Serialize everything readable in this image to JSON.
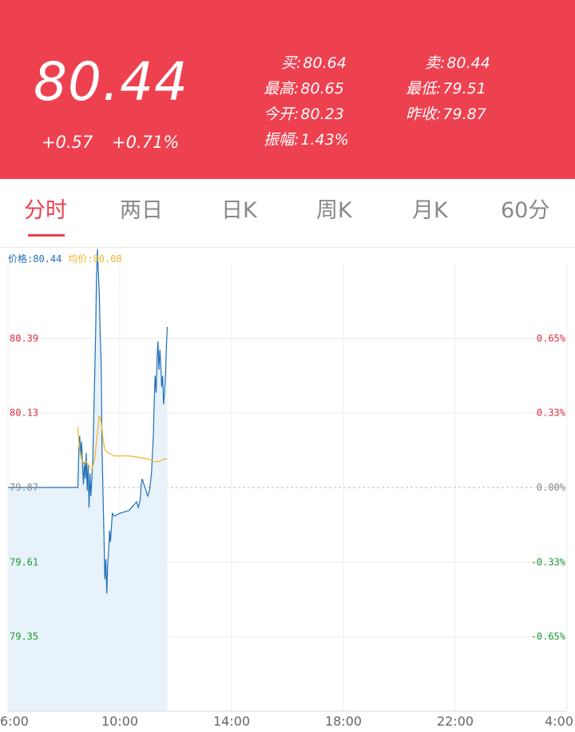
{
  "quote": {
    "price": "80.44",
    "change": "+0.57",
    "change_pct": "+0.71%",
    "stats": [
      {
        "label": "买:",
        "value": "80.64"
      },
      {
        "label": "卖:",
        "value": "80.44"
      },
      {
        "label": "最高:",
        "value": "80.65"
      },
      {
        "label": "最低:",
        "value": "79.51"
      },
      {
        "label": "今开:",
        "value": "80.23"
      },
      {
        "label": "昨收:",
        "value": "79.87"
      },
      {
        "label": "振幅:",
        "value": "1.43%"
      }
    ]
  },
  "tabs": [
    {
      "label": "分时",
      "active": true
    },
    {
      "label": "两日",
      "active": false
    },
    {
      "label": "日K",
      "active": false
    },
    {
      "label": "周K",
      "active": false
    },
    {
      "label": "月K",
      "active": false
    },
    {
      "label": "60分",
      "active": false
    }
  ],
  "legend": {
    "price": "价格:80.44",
    "avg": "均价:80.08"
  },
  "colors": {
    "header": "#ee4150",
    "up": "#e0303f",
    "down": "#1a9a2e",
    "price_line": "#1f6fb8",
    "avg_line": "#f0b429"
  },
  "chart_data": {
    "type": "line",
    "x_ticks": [
      "6:00",
      "10:00",
      "14:00",
      "18:00",
      "22:00",
      "4:00"
    ],
    "y_ticks": [
      "80.39",
      "80.13",
      "79.87",
      "79.61",
      "79.35"
    ],
    "y_right_ticks": [
      "0.65%",
      "0.33%",
      "0.00%",
      "-0.33%",
      "-0.65%"
    ],
    "ylim": [
      79.09,
      80.65
    ],
    "prev_close": 79.87,
    "series": [
      {
        "name": "价格",
        "points": [
          [
            0,
            79.87
          ],
          [
            75,
            79.87
          ],
          [
            76,
            80.0
          ],
          [
            77,
            80.05
          ],
          [
            78,
            79.98
          ],
          [
            79,
            80.03
          ],
          [
            80,
            79.95
          ],
          [
            81,
            79.88
          ],
          [
            82,
            79.96
          ],
          [
            83,
            79.9
          ],
          [
            84,
            79.99
          ],
          [
            85,
            79.86
          ],
          [
            86,
            79.95
          ],
          [
            87,
            79.8
          ],
          [
            88,
            79.92
          ],
          [
            89,
            79.84
          ],
          [
            91,
            79.96
          ],
          [
            92,
            80.1
          ],
          [
            93,
            80.25
          ],
          [
            94,
            80.4
          ],
          [
            95,
            80.6
          ],
          [
            96,
            80.7
          ],
          [
            97,
            80.62
          ],
          [
            98,
            80.55
          ],
          [
            99,
            80.4
          ],
          [
            100,
            80.3
          ],
          [
            101,
            80.0
          ],
          [
            102,
            79.85
          ],
          [
            103,
            79.7
          ],
          [
            104,
            79.55
          ],
          [
            105,
            79.62
          ],
          [
            106,
            79.5
          ],
          [
            107,
            79.6
          ],
          [
            108,
            79.65
          ],
          [
            109,
            79.72
          ],
          [
            110,
            79.68
          ],
          [
            112,
            79.78
          ],
          [
            114,
            79.77
          ],
          [
            120,
            79.78
          ],
          [
            130,
            79.79
          ],
          [
            138,
            79.82
          ],
          [
            140,
            79.8
          ],
          [
            142,
            79.83
          ],
          [
            143,
            79.88
          ],
          [
            144,
            79.9
          ],
          [
            146,
            79.88
          ],
          [
            148,
            79.86
          ],
          [
            150,
            79.84
          ],
          [
            152,
            79.86
          ],
          [
            154,
            79.92
          ],
          [
            156,
            80.05
          ],
          [
            157,
            80.18
          ],
          [
            158,
            80.26
          ],
          [
            159,
            80.2
          ],
          [
            160,
            80.32
          ],
          [
            161,
            80.38
          ],
          [
            162,
            80.28
          ],
          [
            163,
            80.35
          ],
          [
            164,
            80.3
          ],
          [
            165,
            80.22
          ],
          [
            166,
            80.26
          ],
          [
            167,
            80.16
          ],
          [
            168,
            80.2
          ],
          [
            169,
            80.26
          ],
          [
            170,
            80.36
          ],
          [
            171,
            80.43
          ]
        ]
      },
      {
        "name": "均价",
        "points": [
          [
            75,
            80.08
          ],
          [
            76,
            80.03
          ],
          [
            78,
            79.98
          ],
          [
            80,
            79.96
          ],
          [
            82,
            79.95
          ],
          [
            84,
            79.96
          ],
          [
            86,
            79.95
          ],
          [
            90,
            79.93
          ],
          [
            93,
            79.97
          ],
          [
            96,
            80.06
          ],
          [
            98,
            80.12
          ],
          [
            100,
            80.1
          ],
          [
            102,
            80.04
          ],
          [
            104,
            80.0
          ],
          [
            108,
            79.99
          ],
          [
            114,
            79.98
          ],
          [
            130,
            79.98
          ],
          [
            150,
            79.97
          ],
          [
            156,
            79.96
          ],
          [
            162,
            79.96
          ],
          [
            168,
            79.97
          ],
          [
            171,
            79.97
          ]
        ]
      }
    ]
  }
}
